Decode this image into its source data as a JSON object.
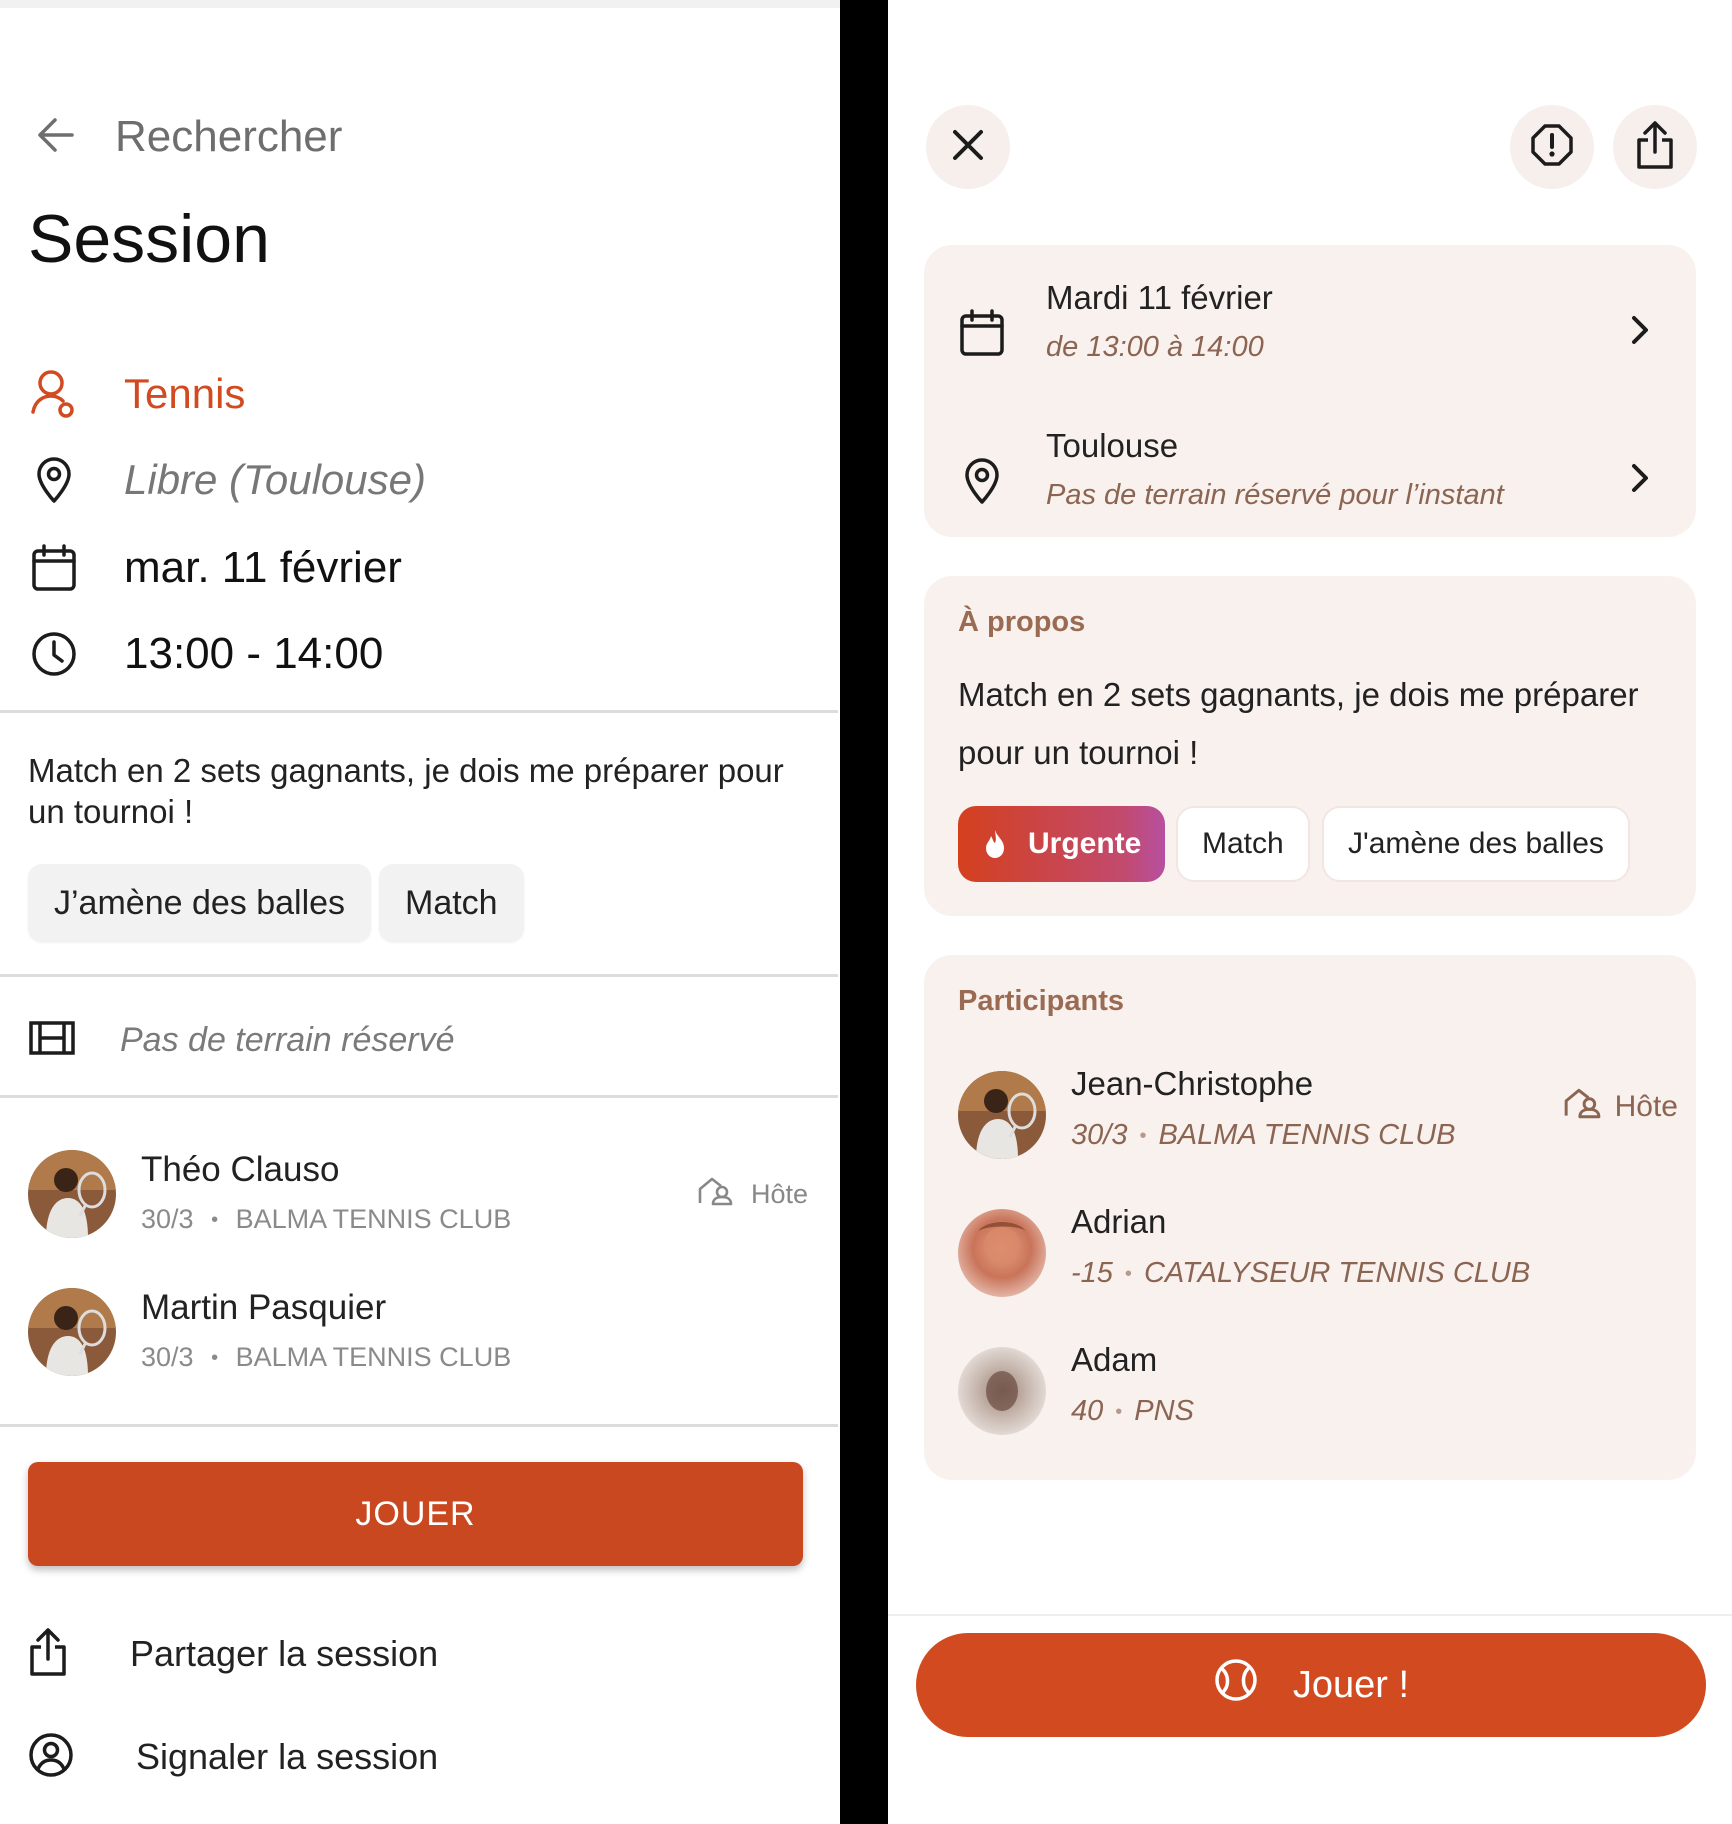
{
  "left": {
    "back_label": "Rechercher",
    "title": "Session",
    "sport": "Tennis",
    "location": "Libre (Toulouse)",
    "date": "mar. 11 février",
    "time": "13:00 - 14:00",
    "description": "Match en 2 sets gagnants, je dois me préparer pour un tournoi !",
    "tags": [
      "J’amène des balles",
      "Match"
    ],
    "court": "Pas de terrain réservé",
    "participants": [
      {
        "name": "Théo Clauso",
        "rank": "30/3",
        "club": "BALMA TENNIS CLUB",
        "role": "Hôte"
      },
      {
        "name": "Martin Pasquier",
        "rank": "30/3",
        "club": "BALMA TENNIS CLUB",
        "role": ""
      }
    ],
    "meta_sep": "•",
    "play_label": "JOUER",
    "share_label": "Partager la session",
    "report_label": "Signaler la session"
  },
  "right": {
    "date_title": "Mardi 11 février",
    "date_sub": "de 13:00 à 14:00",
    "location_title": "Toulouse",
    "location_sub": "Pas de terrain réservé pour l’instant",
    "about_title": "À propos",
    "description": "Match en 2 sets gagnants, je dois me préparer pour un tournoi !",
    "tags": [
      "Urgente",
      "Match",
      "J'amène des balles"
    ],
    "participants_title": "Participants",
    "participants": [
      {
        "name": "Jean-Christophe",
        "rank": "30/3",
        "club": "BALMA TENNIS CLUB",
        "role": "Hôte"
      },
      {
        "name": "Adrian",
        "rank": "-15",
        "club": "CATALYSEUR TENNIS CLUB",
        "role": ""
      },
      {
        "name": "Adam",
        "rank": "40",
        "club": "PNS",
        "role": ""
      }
    ],
    "meta_sep": "•",
    "play_label": "Jouer !"
  },
  "colors": {
    "accent": "#d24a1f",
    "card_bg": "#f9f1ee",
    "muted_brown": "#8b6552"
  },
  "icons": [
    "back-arrow-icon",
    "tennis-player-icon",
    "location-pin-icon",
    "calendar-icon",
    "clock-icon",
    "court-icon",
    "host-icon",
    "share-icon",
    "report-icon",
    "close-icon",
    "alert-icon",
    "chevron-right-icon",
    "flame-icon",
    "ball-icon"
  ]
}
